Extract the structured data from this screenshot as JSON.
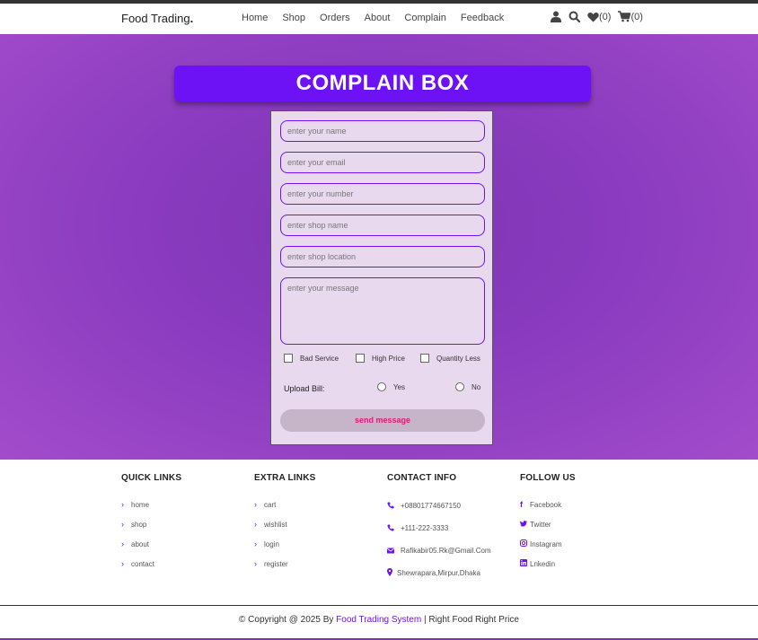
{
  "header": {
    "logo": "Food Trading",
    "logo_dot": ".",
    "nav": [
      "Home",
      "Shop",
      "Orders",
      "About",
      "Complain",
      "Feedback"
    ],
    "wishlist_count": "(0)",
    "cart_count": "(0)",
    "icons": [
      "user-icon",
      "search-icon",
      "heart-icon",
      "cart-icon"
    ]
  },
  "complain": {
    "title": "COMPLAIN BOX",
    "fields": {
      "name_placeholder": "enter your name",
      "email_placeholder": "enter your email",
      "number_placeholder": "enter your number",
      "shop_placeholder": "enter shop name",
      "location_placeholder": "enter shop location",
      "message_placeholder": "enter your message"
    },
    "checkboxes": [
      "Bad Service",
      "High Price",
      "Quantity Less"
    ],
    "upload_label": "Upload Bill:",
    "radios": [
      "Yes",
      "No"
    ],
    "send_label": "send message"
  },
  "footer": {
    "quick_links": {
      "title": "QUICK LINKS",
      "items": [
        "home",
        "shop",
        "about",
        "contact"
      ]
    },
    "extra_links": {
      "title": "EXTRA LINKS",
      "items": [
        "cart",
        "wishlist",
        "login",
        "register"
      ]
    },
    "contact_info": {
      "title": "CONTACT INFO",
      "items": [
        "+08801774667150",
        "+111-222-3333",
        "Rafikabir05.Rk@Gmail.Com",
        "Shewrapara,Mirpur,Dhaka"
      ]
    },
    "follow_us": {
      "title": "FOLLOW US",
      "items": [
        "Facebook",
        "Twitter",
        "Instagram",
        "Lnkedin"
      ]
    },
    "copyright_prefix": "© Copyright @ 2025 By",
    "brand": "Food Trading System",
    "copyright_suffix": "| Right Food Right Price"
  },
  "colors": {
    "accent": "#6d12f5",
    "hero_purple": "#8a3bbf",
    "form_bg": "#e8d9ee",
    "send_text": "#e0197a"
  }
}
